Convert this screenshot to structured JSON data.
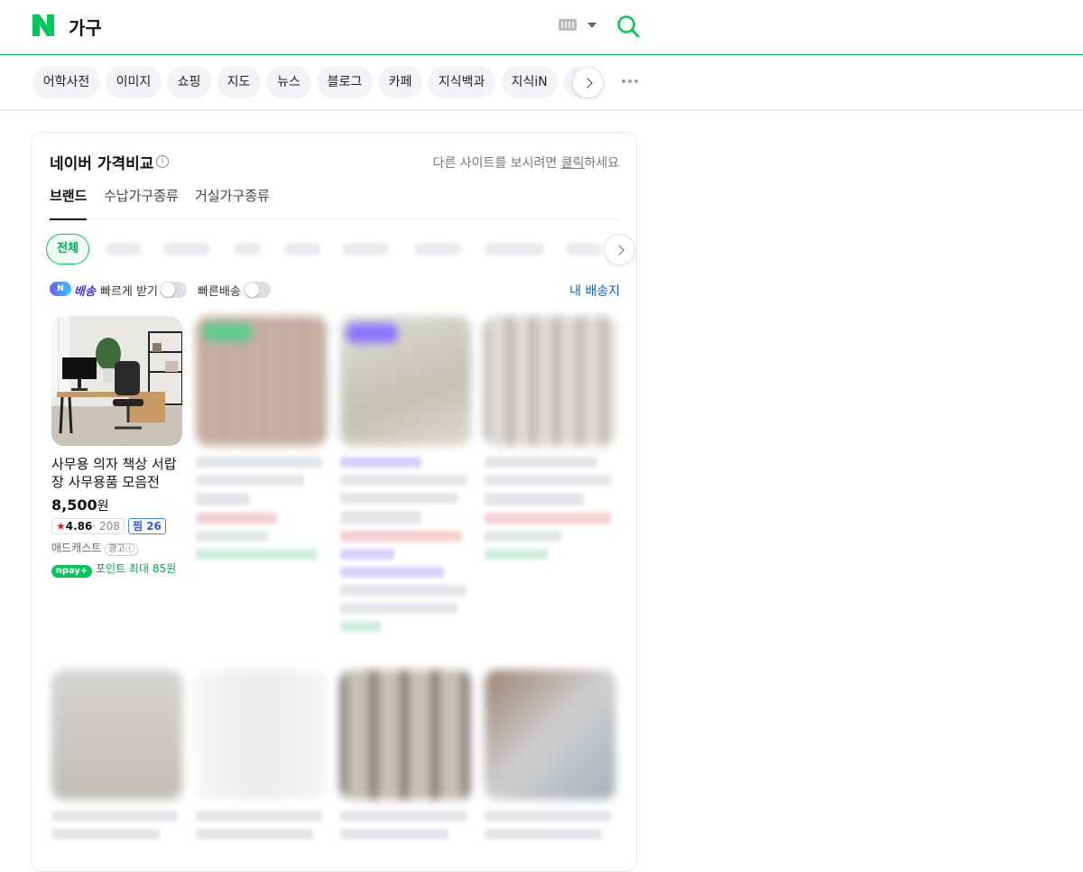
{
  "header": {
    "query": "가구",
    "search_icon": "search-icon",
    "keyboard_icon": "keyboard-icon",
    "brand_color": "#03c75a"
  },
  "tabs": {
    "items": [
      "어학사전",
      "이미지",
      "쇼핑",
      "지도",
      "뉴스",
      "블로그",
      "카페",
      "지식백과",
      "지식iN"
    ],
    "more_icon": "more-icon"
  },
  "shopping": {
    "title": "네이버 가격비교",
    "other_sites_prefix": "다른 사이트를 보시려면 ",
    "other_sites_link": "클릭",
    "other_sites_suffix": "하세요",
    "subtabs": [
      "브랜드",
      "수납가구종류",
      "거실가구종류"
    ],
    "active_subtab": "브랜드",
    "brand_chip_all": "전체",
    "delivery": {
      "badge": "N",
      "word": "배송",
      "label": "빠르게 받기",
      "fast_label": "빠른배송",
      "my_address": "내 배송지"
    },
    "products": [
      {
        "name": "사무용 의자 책상 서랍장 사무용품 모음전",
        "price": "8,500",
        "price_unit": "원",
        "rating": "4.86",
        "reviews": "208",
        "zzim_label": "찜",
        "zzim": "26",
        "seller": "애드캐스트",
        "ad_label": "광고ⓘ",
        "pay_badge": "npay+",
        "points": "포인트 최대 85원"
      }
    ]
  }
}
